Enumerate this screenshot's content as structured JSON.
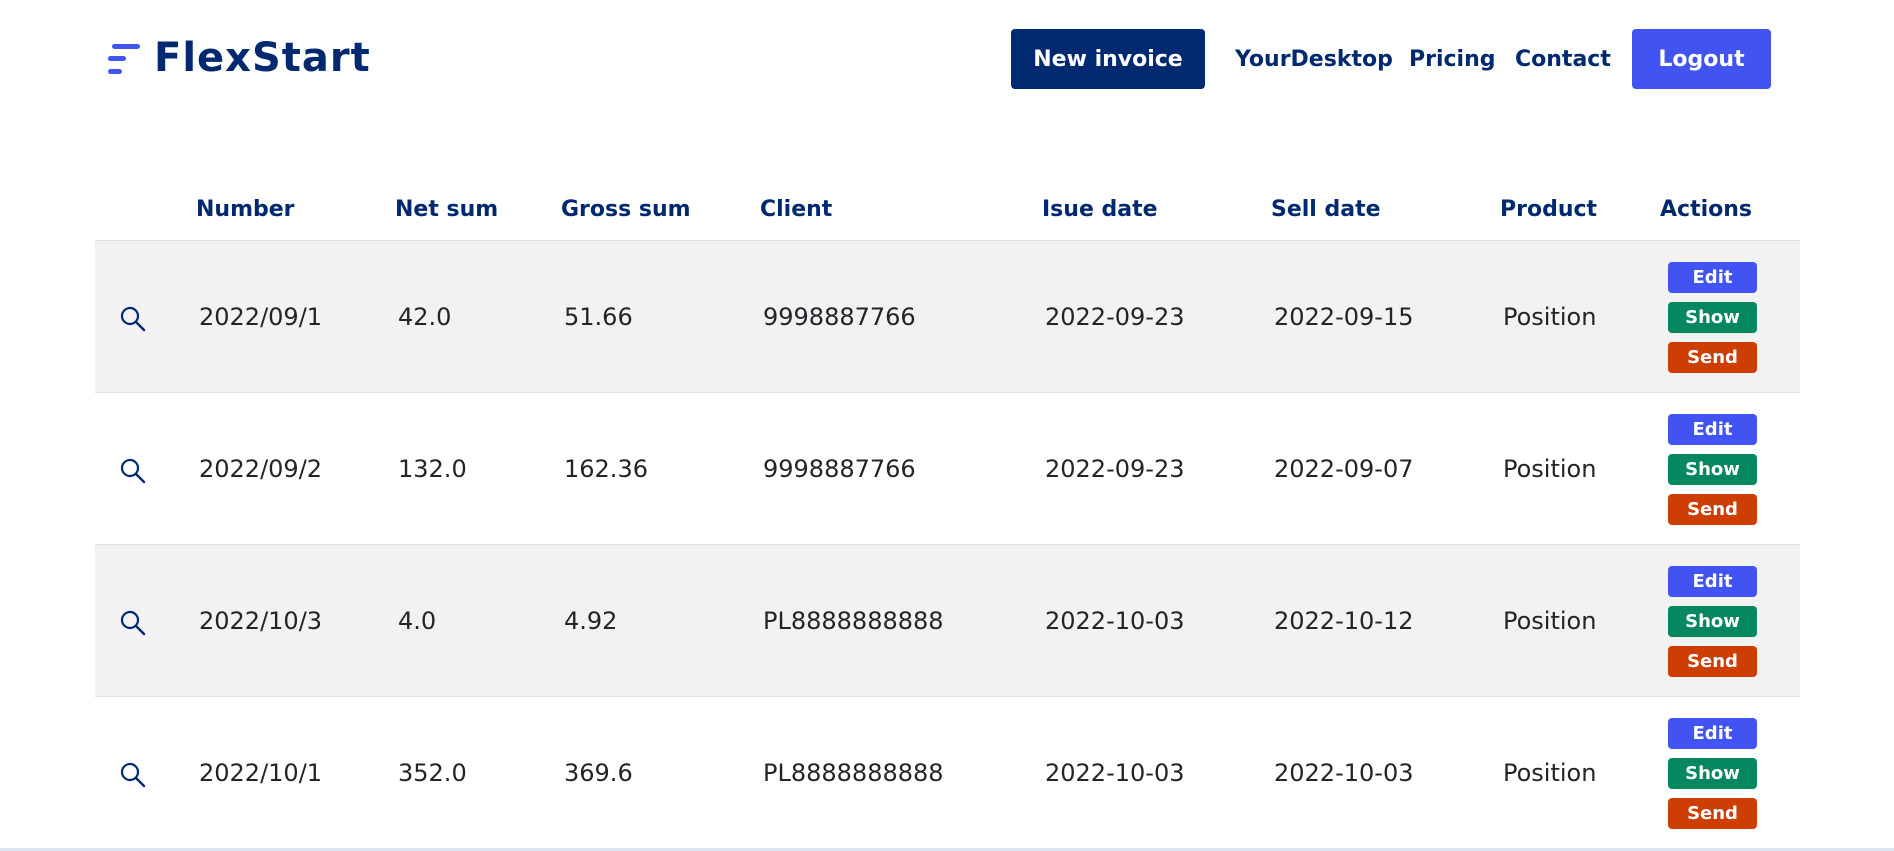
{
  "brand": {
    "name": "FlexStart"
  },
  "nav": {
    "new_invoice": "New invoice",
    "links": [
      "YourDesktop",
      "Pricing",
      "Contact"
    ],
    "logout": "Logout"
  },
  "table": {
    "headers": [
      "Number",
      "Net sum",
      "Gross sum",
      "Client",
      "Isue date",
      "Sell date",
      "Product",
      "Actions"
    ],
    "rows": [
      {
        "number": "2022/09/1",
        "net": "42.0",
        "gross": "51.66",
        "client": "9998887766",
        "issue": "2022-09-23",
        "sell": "2022-09-15",
        "product": "Position"
      },
      {
        "number": "2022/09/2",
        "net": "132.0",
        "gross": "162.36",
        "client": "9998887766",
        "issue": "2022-09-23",
        "sell": "2022-09-07",
        "product": "Position"
      },
      {
        "number": "2022/10/3",
        "net": "4.0",
        "gross": "4.92",
        "client": "PL8888888888",
        "issue": "2022-10-03",
        "sell": "2022-10-12",
        "product": "Position"
      },
      {
        "number": "2022/10/1",
        "net": "352.0",
        "gross": "369.6",
        "client": "PL8888888888",
        "issue": "2022-10-03",
        "sell": "2022-10-03",
        "product": "Position"
      }
    ],
    "row_actions": {
      "edit": "Edit",
      "show": "Show",
      "send": "Send"
    },
    "row_icon": "search-icon"
  },
  "colors": {
    "navy": "#012970",
    "primary": "#4154f1",
    "show": "#05875f",
    "send": "#cc3e04",
    "row_shade": "#f2f2f2"
  }
}
